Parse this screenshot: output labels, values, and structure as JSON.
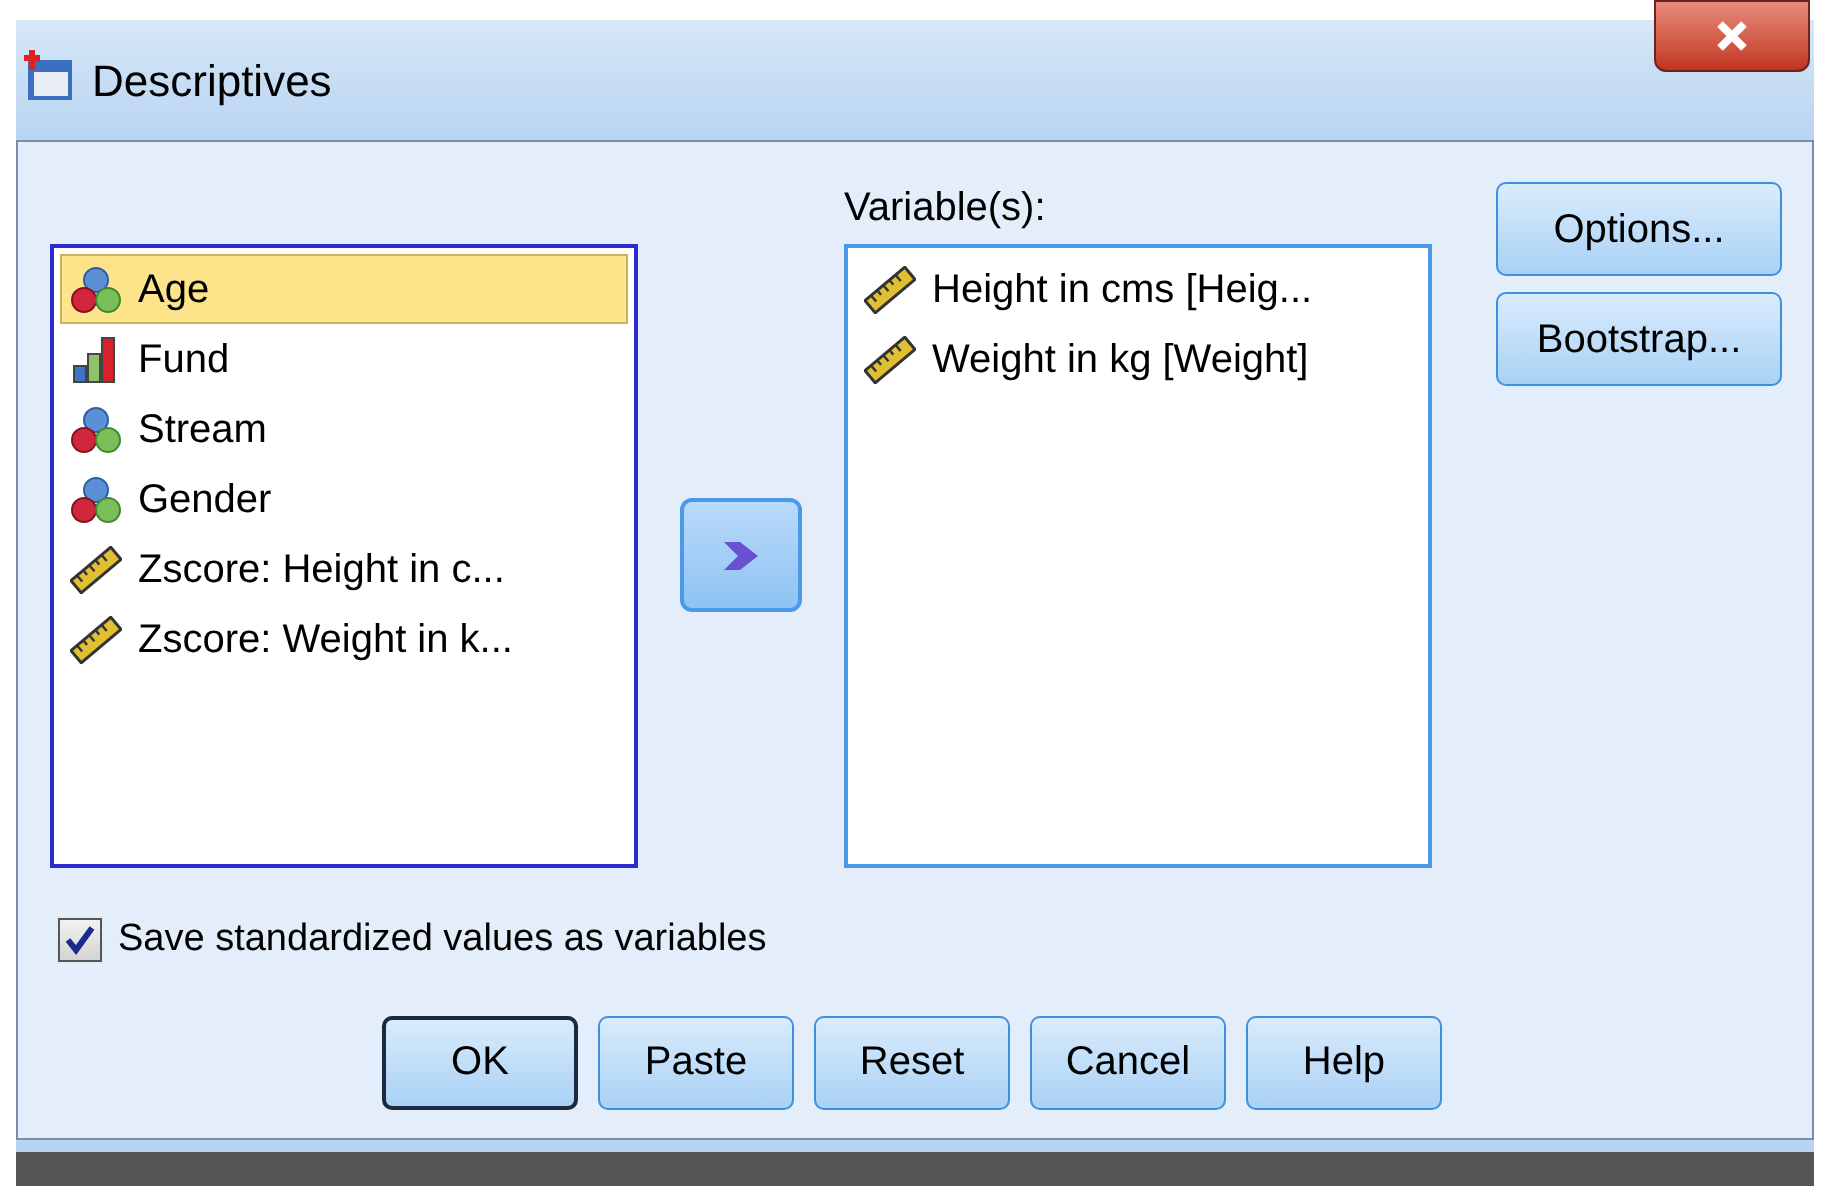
{
  "window": {
    "title": "Descriptives"
  },
  "source_list": {
    "items": [
      {
        "label": "Age",
        "kind": "nominal",
        "selected": true
      },
      {
        "label": "Fund",
        "kind": "ordinal",
        "selected": false
      },
      {
        "label": "Stream",
        "kind": "nominal",
        "selected": false
      },
      {
        "label": "Gender",
        "kind": "nominal",
        "selected": false
      },
      {
        "label": "Zscore:  Height in c...",
        "kind": "scale",
        "selected": false
      },
      {
        "label": "Zscore:  Weight in k...",
        "kind": "scale",
        "selected": false
      }
    ]
  },
  "variables_list": {
    "label": "Variable(s):",
    "items": [
      {
        "label": "Height in cms [Heig...",
        "kind": "scale",
        "selected": false
      },
      {
        "label": "Weight in kg [Weight]",
        "kind": "scale",
        "selected": false
      }
    ]
  },
  "side_buttons": [
    "Options...",
    "Bootstrap..."
  ],
  "save_standardized": {
    "label": "Save standardized values as variables",
    "checked": true
  },
  "buttons": [
    {
      "label": "OK",
      "default": true
    },
    {
      "label": "Paste",
      "default": false
    },
    {
      "label": "Reset",
      "default": false
    },
    {
      "label": "Cancel",
      "default": false
    },
    {
      "label": "Help",
      "default": false
    }
  ]
}
